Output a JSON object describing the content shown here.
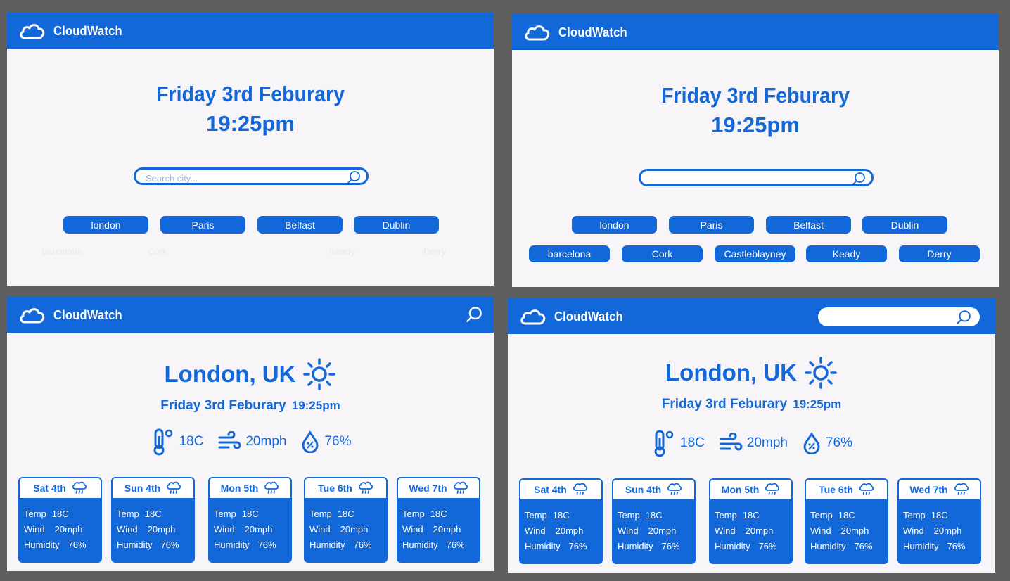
{
  "app_name": "CloudWatch",
  "home": {
    "date": "Friday 3rd Feburary",
    "time": "19:25pm",
    "search_placeholder": "Search city...",
    "cities": [
      "london",
      "Paris",
      "Belfast",
      "Dublin"
    ],
    "cities_more": [
      "barcelona",
      "Cork",
      "Castleblayney",
      "Keady",
      "Derry"
    ]
  },
  "weather": {
    "city": "London, UK",
    "date": "Friday 3rd Feburary",
    "time": "19:25pm",
    "temp": "18C",
    "wind": "20mph",
    "humidity": "76%",
    "labels": {
      "temp": "Temp",
      "wind": "Wind",
      "humidity": "Humidity"
    },
    "forecast": [
      {
        "day": "Sat 4th",
        "temp": "18C",
        "wind": "20mph",
        "humidity": "76%"
      },
      {
        "day": "Sun 4th",
        "temp": "18C",
        "wind": "20mph",
        "humidity": "76%"
      },
      {
        "day": "Mon 5th",
        "temp": "18C",
        "wind": "20mph",
        "humidity": "76%"
      },
      {
        "day": "Tue 6th",
        "temp": "18C",
        "wind": "20mph",
        "humidity": "76%"
      },
      {
        "day": "Wed 7th",
        "temp": "18C",
        "wind": "20mph",
        "humidity": "76%"
      }
    ]
  },
  "colors": {
    "brand": "#1268d9",
    "panel": "#f7f5f7",
    "background": "#5f5f5f"
  }
}
